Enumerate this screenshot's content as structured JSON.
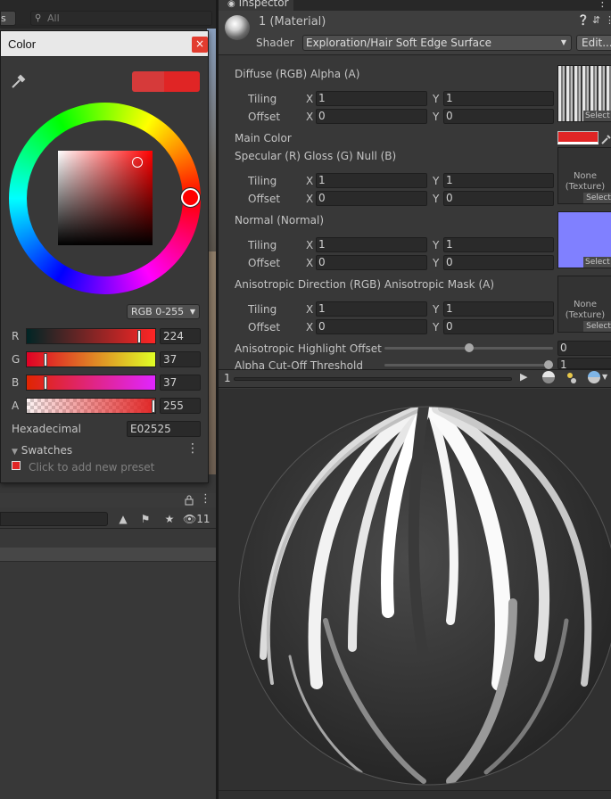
{
  "top_left": {
    "tab_label": "s",
    "search_placeholder": "All"
  },
  "color_picker": {
    "title": "Color",
    "close_glyph": "×",
    "mode": "RGB 0-255",
    "channels": [
      {
        "label": "R",
        "value": "224"
      },
      {
        "label": "G",
        "value": "37"
      },
      {
        "label": "B",
        "value": "37"
      },
      {
        "label": "A",
        "value": "255"
      }
    ],
    "hex_label": "Hexadecimal",
    "hex_value": "E02525",
    "swatches_label": "Swatches",
    "preset_hint": "Click to add new preset",
    "current_color": "#e02525",
    "previous_color": "#d63a3a"
  },
  "project": {
    "hidden_count": "11"
  },
  "inspector": {
    "tab_label": "Inspector",
    "material_name": "1 (Material)",
    "shader_label": "Shader",
    "shader_value": "Exploration/Hair Soft Edge Surface",
    "edit_label": "Edit...",
    "tiling_label": "Tiling",
    "offset_label": "Offset",
    "x_label": "X",
    "y_label": "Y",
    "select_label": "Select",
    "none_texture": "None\n(Texture)",
    "properties": {
      "diffuse": {
        "label": "Diffuse (RGB) Alpha (A)",
        "tiling_x": "1",
        "tiling_y": "1",
        "offset_x": "0",
        "offset_y": "0"
      },
      "main_color": {
        "label": "Main Color",
        "color": "#e02525"
      },
      "specular": {
        "label": "Specular (R) Gloss (G) Null (B)",
        "tiling_x": "1",
        "tiling_y": "1",
        "offset_x": "0",
        "offset_y": "0"
      },
      "normal": {
        "label": "Normal (Normal)",
        "tiling_x": "1",
        "tiling_y": "1",
        "offset_x": "0",
        "offset_y": "0"
      },
      "anisotropic": {
        "label": "Anisotropic Direction (RGB) Anisotropic Mask (A)",
        "tiling_x": "1",
        "tiling_y": "1",
        "offset_x": "0",
        "offset_y": "0"
      },
      "highlight_offset": {
        "label": "Anisotropic Highlight Offset",
        "value": "0"
      },
      "alpha_cutoff": {
        "label": "Alpha Cut-Off Threshold",
        "value": "1"
      }
    },
    "preview_index": "1"
  }
}
